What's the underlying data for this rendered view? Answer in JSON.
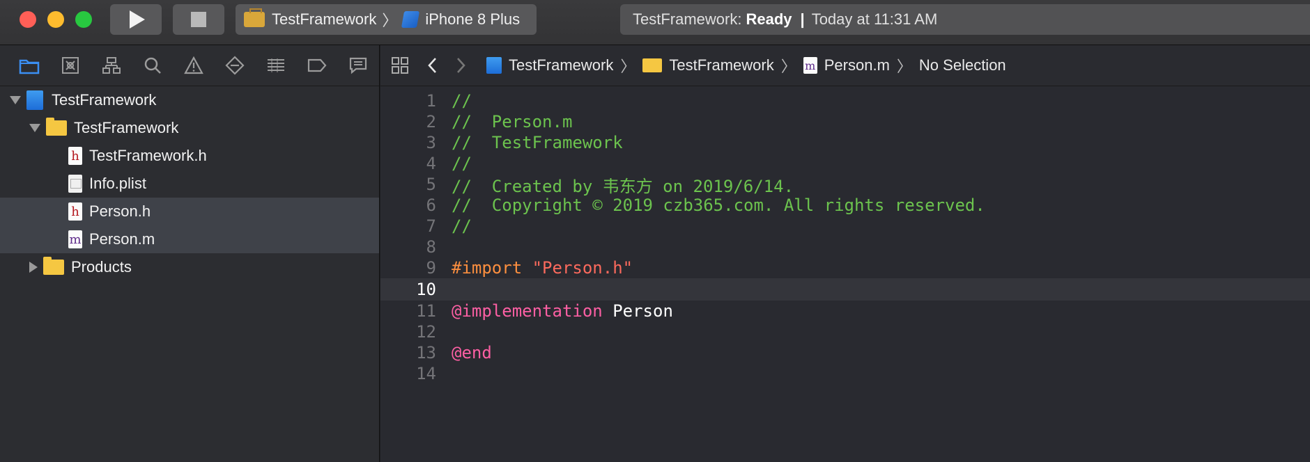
{
  "toolbar": {
    "scheme_name": "TestFramework",
    "device_name": "iPhone 8 Plus",
    "status_prefix": "TestFramework:",
    "status_state": "Ready",
    "status_sep": "|",
    "status_time": "Today at 11:31 AM"
  },
  "navigator": {
    "tabs": [
      "folder-icon",
      "source-control-icon",
      "hierarchy-icon",
      "search-icon",
      "warning-icon",
      "test-icon",
      "debug-icon",
      "breakpoint-icon",
      "report-icon"
    ],
    "items": [
      {
        "label": "TestFramework",
        "kind": "project"
      },
      {
        "label": "TestFramework",
        "kind": "folder"
      },
      {
        "label": "TestFramework.h",
        "kind": "h"
      },
      {
        "label": "Info.plist",
        "kind": "plist"
      },
      {
        "label": "Person.h",
        "kind": "h"
      },
      {
        "label": "Person.m",
        "kind": "m"
      },
      {
        "label": "Products",
        "kind": "folder"
      }
    ]
  },
  "jumpbar": {
    "crumbs": [
      "TestFramework",
      "TestFramework",
      "Person.m",
      "No Selection"
    ]
  },
  "editor": {
    "current_line": 10,
    "lines": [
      {
        "n": "1",
        "text": "//"
      },
      {
        "n": "2",
        "text": "//  Person.m"
      },
      {
        "n": "3",
        "text": "//  TestFramework"
      },
      {
        "n": "4",
        "text": "//"
      },
      {
        "n": "5",
        "text": "//  Created by 韦东方 on 2019/6/14."
      },
      {
        "n": "6",
        "text": "//  Copyright © 2019 czb365.com. All rights reserved."
      },
      {
        "n": "7",
        "text": "//"
      },
      {
        "n": "8",
        "text": ""
      },
      {
        "n": "9",
        "pre": "#import",
        "str": "\"Person.h\""
      },
      {
        "n": "10",
        "text": ""
      },
      {
        "n": "11",
        "kw": "@implementation",
        "plain": "Person"
      },
      {
        "n": "12",
        "text": ""
      },
      {
        "n": "13",
        "kw": "@end"
      },
      {
        "n": "14",
        "text": ""
      }
    ]
  },
  "colors": {
    "comment": "#6cc34e",
    "preprocessor": "#fd8f3f",
    "string": "#fc6a5d",
    "keyword": "#fc5fa3",
    "selection": "#3f4249"
  }
}
